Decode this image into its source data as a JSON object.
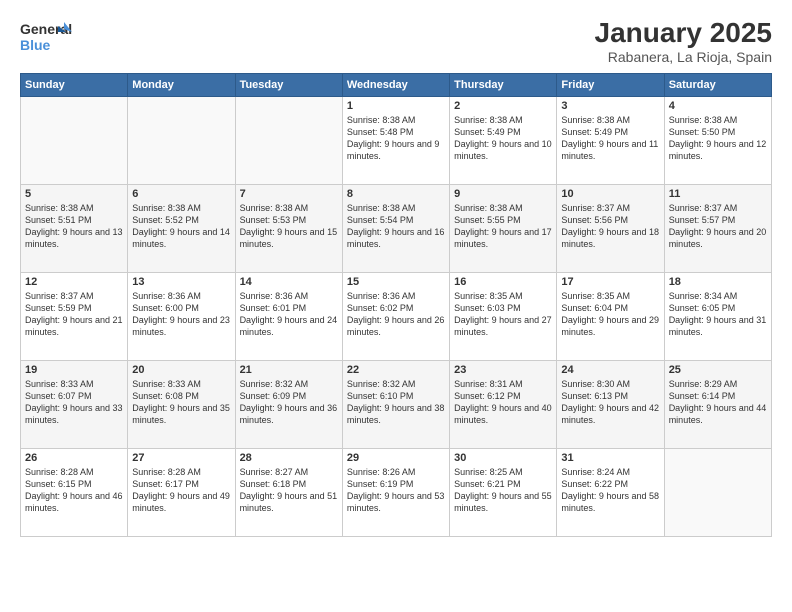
{
  "logo": {
    "line1": "General",
    "line2": "Blue"
  },
  "title": "January 2025",
  "location": "Rabanera, La Rioja, Spain",
  "weekdays": [
    "Sunday",
    "Monday",
    "Tuesday",
    "Wednesday",
    "Thursday",
    "Friday",
    "Saturday"
  ],
  "weeks": [
    [
      {
        "day": "",
        "sunrise": "",
        "sunset": "",
        "daylight": ""
      },
      {
        "day": "",
        "sunrise": "",
        "sunset": "",
        "daylight": ""
      },
      {
        "day": "",
        "sunrise": "",
        "sunset": "",
        "daylight": ""
      },
      {
        "day": "1",
        "sunrise": "Sunrise: 8:38 AM",
        "sunset": "Sunset: 5:48 PM",
        "daylight": "Daylight: 9 hours and 9 minutes."
      },
      {
        "day": "2",
        "sunrise": "Sunrise: 8:38 AM",
        "sunset": "Sunset: 5:49 PM",
        "daylight": "Daylight: 9 hours and 10 minutes."
      },
      {
        "day": "3",
        "sunrise": "Sunrise: 8:38 AM",
        "sunset": "Sunset: 5:49 PM",
        "daylight": "Daylight: 9 hours and 11 minutes."
      },
      {
        "day": "4",
        "sunrise": "Sunrise: 8:38 AM",
        "sunset": "Sunset: 5:50 PM",
        "daylight": "Daylight: 9 hours and 12 minutes."
      }
    ],
    [
      {
        "day": "5",
        "sunrise": "Sunrise: 8:38 AM",
        "sunset": "Sunset: 5:51 PM",
        "daylight": "Daylight: 9 hours and 13 minutes."
      },
      {
        "day": "6",
        "sunrise": "Sunrise: 8:38 AM",
        "sunset": "Sunset: 5:52 PM",
        "daylight": "Daylight: 9 hours and 14 minutes."
      },
      {
        "day": "7",
        "sunrise": "Sunrise: 8:38 AM",
        "sunset": "Sunset: 5:53 PM",
        "daylight": "Daylight: 9 hours and 15 minutes."
      },
      {
        "day": "8",
        "sunrise": "Sunrise: 8:38 AM",
        "sunset": "Sunset: 5:54 PM",
        "daylight": "Daylight: 9 hours and 16 minutes."
      },
      {
        "day": "9",
        "sunrise": "Sunrise: 8:38 AM",
        "sunset": "Sunset: 5:55 PM",
        "daylight": "Daylight: 9 hours and 17 minutes."
      },
      {
        "day": "10",
        "sunrise": "Sunrise: 8:37 AM",
        "sunset": "Sunset: 5:56 PM",
        "daylight": "Daylight: 9 hours and 18 minutes."
      },
      {
        "day": "11",
        "sunrise": "Sunrise: 8:37 AM",
        "sunset": "Sunset: 5:57 PM",
        "daylight": "Daylight: 9 hours and 20 minutes."
      }
    ],
    [
      {
        "day": "12",
        "sunrise": "Sunrise: 8:37 AM",
        "sunset": "Sunset: 5:59 PM",
        "daylight": "Daylight: 9 hours and 21 minutes."
      },
      {
        "day": "13",
        "sunrise": "Sunrise: 8:36 AM",
        "sunset": "Sunset: 6:00 PM",
        "daylight": "Daylight: 9 hours and 23 minutes."
      },
      {
        "day": "14",
        "sunrise": "Sunrise: 8:36 AM",
        "sunset": "Sunset: 6:01 PM",
        "daylight": "Daylight: 9 hours and 24 minutes."
      },
      {
        "day": "15",
        "sunrise": "Sunrise: 8:36 AM",
        "sunset": "Sunset: 6:02 PM",
        "daylight": "Daylight: 9 hours and 26 minutes."
      },
      {
        "day": "16",
        "sunrise": "Sunrise: 8:35 AM",
        "sunset": "Sunset: 6:03 PM",
        "daylight": "Daylight: 9 hours and 27 minutes."
      },
      {
        "day": "17",
        "sunrise": "Sunrise: 8:35 AM",
        "sunset": "Sunset: 6:04 PM",
        "daylight": "Daylight: 9 hours and 29 minutes."
      },
      {
        "day": "18",
        "sunrise": "Sunrise: 8:34 AM",
        "sunset": "Sunset: 6:05 PM",
        "daylight": "Daylight: 9 hours and 31 minutes."
      }
    ],
    [
      {
        "day": "19",
        "sunrise": "Sunrise: 8:33 AM",
        "sunset": "Sunset: 6:07 PM",
        "daylight": "Daylight: 9 hours and 33 minutes."
      },
      {
        "day": "20",
        "sunrise": "Sunrise: 8:33 AM",
        "sunset": "Sunset: 6:08 PM",
        "daylight": "Daylight: 9 hours and 35 minutes."
      },
      {
        "day": "21",
        "sunrise": "Sunrise: 8:32 AM",
        "sunset": "Sunset: 6:09 PM",
        "daylight": "Daylight: 9 hours and 36 minutes."
      },
      {
        "day": "22",
        "sunrise": "Sunrise: 8:32 AM",
        "sunset": "Sunset: 6:10 PM",
        "daylight": "Daylight: 9 hours and 38 minutes."
      },
      {
        "day": "23",
        "sunrise": "Sunrise: 8:31 AM",
        "sunset": "Sunset: 6:12 PM",
        "daylight": "Daylight: 9 hours and 40 minutes."
      },
      {
        "day": "24",
        "sunrise": "Sunrise: 8:30 AM",
        "sunset": "Sunset: 6:13 PM",
        "daylight": "Daylight: 9 hours and 42 minutes."
      },
      {
        "day": "25",
        "sunrise": "Sunrise: 8:29 AM",
        "sunset": "Sunset: 6:14 PM",
        "daylight": "Daylight: 9 hours and 44 minutes."
      }
    ],
    [
      {
        "day": "26",
        "sunrise": "Sunrise: 8:28 AM",
        "sunset": "Sunset: 6:15 PM",
        "daylight": "Daylight: 9 hours and 46 minutes."
      },
      {
        "day": "27",
        "sunrise": "Sunrise: 8:28 AM",
        "sunset": "Sunset: 6:17 PM",
        "daylight": "Daylight: 9 hours and 49 minutes."
      },
      {
        "day": "28",
        "sunrise": "Sunrise: 8:27 AM",
        "sunset": "Sunset: 6:18 PM",
        "daylight": "Daylight: 9 hours and 51 minutes."
      },
      {
        "day": "29",
        "sunrise": "Sunrise: 8:26 AM",
        "sunset": "Sunset: 6:19 PM",
        "daylight": "Daylight: 9 hours and 53 minutes."
      },
      {
        "day": "30",
        "sunrise": "Sunrise: 8:25 AM",
        "sunset": "Sunset: 6:21 PM",
        "daylight": "Daylight: 9 hours and 55 minutes."
      },
      {
        "day": "31",
        "sunrise": "Sunrise: 8:24 AM",
        "sunset": "Sunset: 6:22 PM",
        "daylight": "Daylight: 9 hours and 58 minutes."
      },
      {
        "day": "",
        "sunrise": "",
        "sunset": "",
        "daylight": ""
      }
    ]
  ]
}
